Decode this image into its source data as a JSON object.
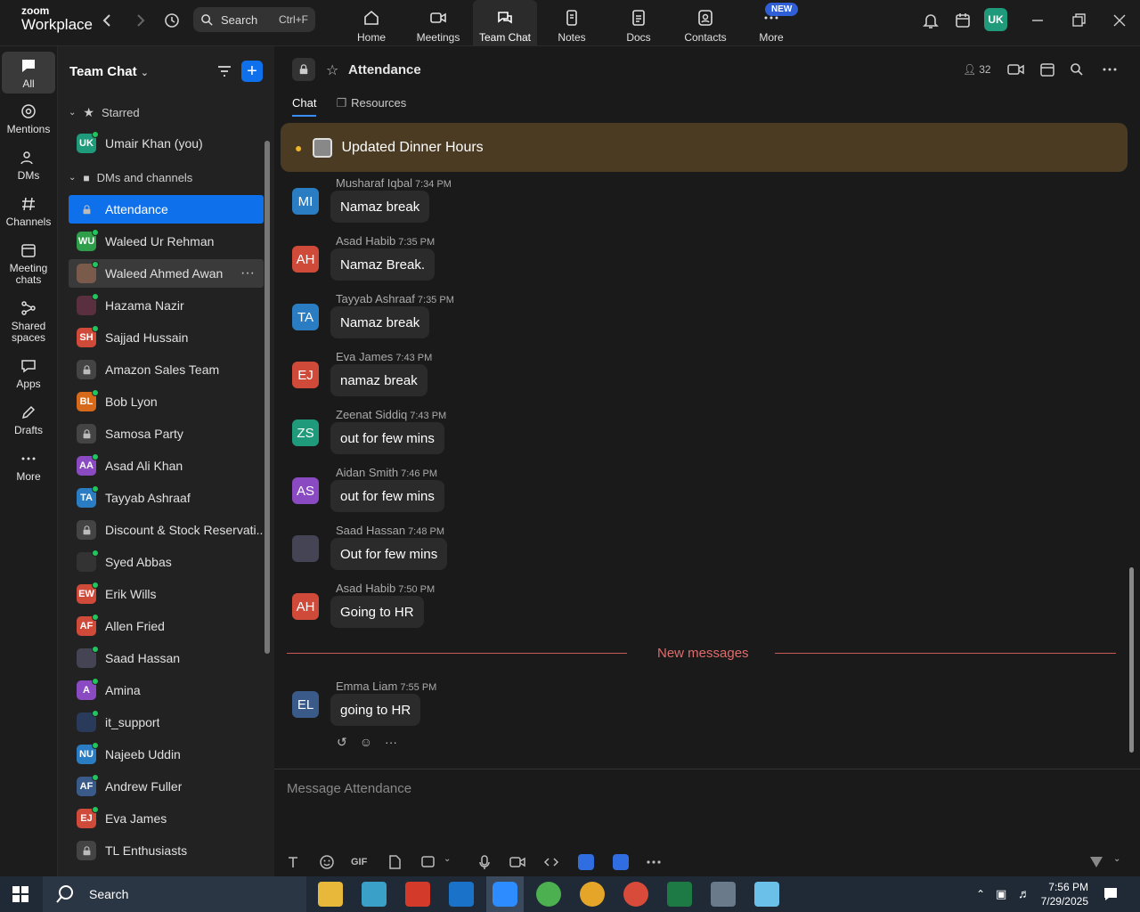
{
  "app": {
    "brand_line1": "zoom",
    "brand_line2": "Workplace"
  },
  "search": {
    "label": "Search",
    "shortcut": "Ctrl+F"
  },
  "nav": [
    {
      "label": "Home"
    },
    {
      "label": "Meetings"
    },
    {
      "label": "Team Chat"
    },
    {
      "label": "Notes"
    },
    {
      "label": "Docs"
    },
    {
      "label": "Contacts"
    },
    {
      "label": "More"
    }
  ],
  "nav_badge": "NEW",
  "user_initials": "UK",
  "rail": [
    {
      "label": "All"
    },
    {
      "label": "Mentions"
    },
    {
      "label": "DMs"
    },
    {
      "label": "Channels"
    },
    {
      "label": "Meeting chats"
    },
    {
      "label": "Shared spaces"
    },
    {
      "label": "Apps"
    },
    {
      "label": "Drafts"
    },
    {
      "label": "More"
    }
  ],
  "sidebar": {
    "title": "Team Chat",
    "starred_label": "Starred",
    "starred": [
      {
        "initials": "UK",
        "name": "Umair Khan (you)",
        "color": "#1f9a7a"
      }
    ],
    "dms_label": "DMs and channels",
    "items": [
      {
        "name": "Attendance",
        "type": "lock"
      },
      {
        "name": "Waleed Ur Rehman",
        "initials": "WU",
        "color": "#2e9e4a"
      },
      {
        "name": "Waleed Ahmed Awan",
        "initials": "",
        "color": "#7a5a4a"
      },
      {
        "name": "Hazama Nazir",
        "initials": "",
        "color": "#5a3040"
      },
      {
        "name": "Sajjad Hussain",
        "initials": "SH",
        "color": "#d04a3a"
      },
      {
        "name": "Amazon Sales Team",
        "type": "lock"
      },
      {
        "name": "Bob Lyon",
        "initials": "BL",
        "color": "#d66a1a"
      },
      {
        "name": "Samosa Party",
        "type": "lock"
      },
      {
        "name": "Asad Ali Khan",
        "initials": "AA",
        "color": "#8a4ac2"
      },
      {
        "name": "Tayyab Ashraaf",
        "initials": "TA",
        "color": "#2a7dc2"
      },
      {
        "name": "Discount & Stock Reservati...",
        "type": "lock"
      },
      {
        "name": "Syed Abbas",
        "initials": "",
        "color": "#333"
      },
      {
        "name": "Erik Wills",
        "initials": "EW",
        "color": "#d04a3a"
      },
      {
        "name": "Allen Fried",
        "initials": "AF",
        "color": "#d04a3a"
      },
      {
        "name": "Saad Hassan",
        "initials": "",
        "color": "#445"
      },
      {
        "name": "Amina",
        "initials": "A",
        "color": "#8a4ac2"
      },
      {
        "name": "it_support",
        "initials": "",
        "color": "#2a3a5a"
      },
      {
        "name": "Najeeb Uddin",
        "initials": "NU",
        "color": "#2a7dc2"
      },
      {
        "name": "Andrew Fuller",
        "initials": "AF",
        "color": "#3a5a8a"
      },
      {
        "name": "Eva James",
        "initials": "EJ",
        "color": "#d04a3a"
      },
      {
        "name": "TL Enthusiasts",
        "type": "lock"
      }
    ]
  },
  "channel": {
    "title": "Attendance",
    "member_count": "32",
    "tabs": [
      "Chat",
      "Resources"
    ]
  },
  "pinned": "Updated Dinner Hours",
  "messages": [
    {
      "initials": "MI",
      "name": "Musharaf Iqbal",
      "time": "7:34 PM",
      "text": "Namaz break",
      "color": "#2a7dc2"
    },
    {
      "initials": "AH",
      "name": "Asad Habib",
      "time": "7:35 PM",
      "text": "Namaz Break.",
      "color": "#d04a3a"
    },
    {
      "initials": "TA",
      "name": "Tayyab Ashraaf",
      "time": "7:35 PM",
      "text": "Namaz break",
      "color": "#2a7dc2"
    },
    {
      "initials": "EJ",
      "name": "Eva James",
      "time": "7:43 PM",
      "text": "namaz break",
      "color": "#d04a3a"
    },
    {
      "initials": "ZS",
      "name": "Zeenat Siddiq",
      "time": "7:43 PM",
      "text": "out for few mins",
      "color": "#1f9a7a"
    },
    {
      "initials": "AS",
      "name": "Aidan Smith",
      "time": "7:46 PM",
      "text": "out for few mins",
      "color": "#8a4ac2"
    },
    {
      "initials": "",
      "name": "Saad Hassan",
      "time": "7:48 PM",
      "text": "Out for few mins",
      "color": "#445"
    },
    {
      "initials": "AH",
      "name": "Asad Habib",
      "time": "7:50 PM",
      "text": "Going to HR",
      "color": "#d04a3a"
    }
  ],
  "new_messages_label": "New messages",
  "new_message": {
    "initials": "EL",
    "name": "Emma Liam",
    "time": "7:55 PM",
    "text": "going to HR",
    "color": "#3a5a8a"
  },
  "composer": {
    "placeholder": "Message Attendance",
    "gif_label": "GIF"
  },
  "taskbar": {
    "search": "Search",
    "time": "7:56 PM",
    "date": "7/29/2025"
  }
}
